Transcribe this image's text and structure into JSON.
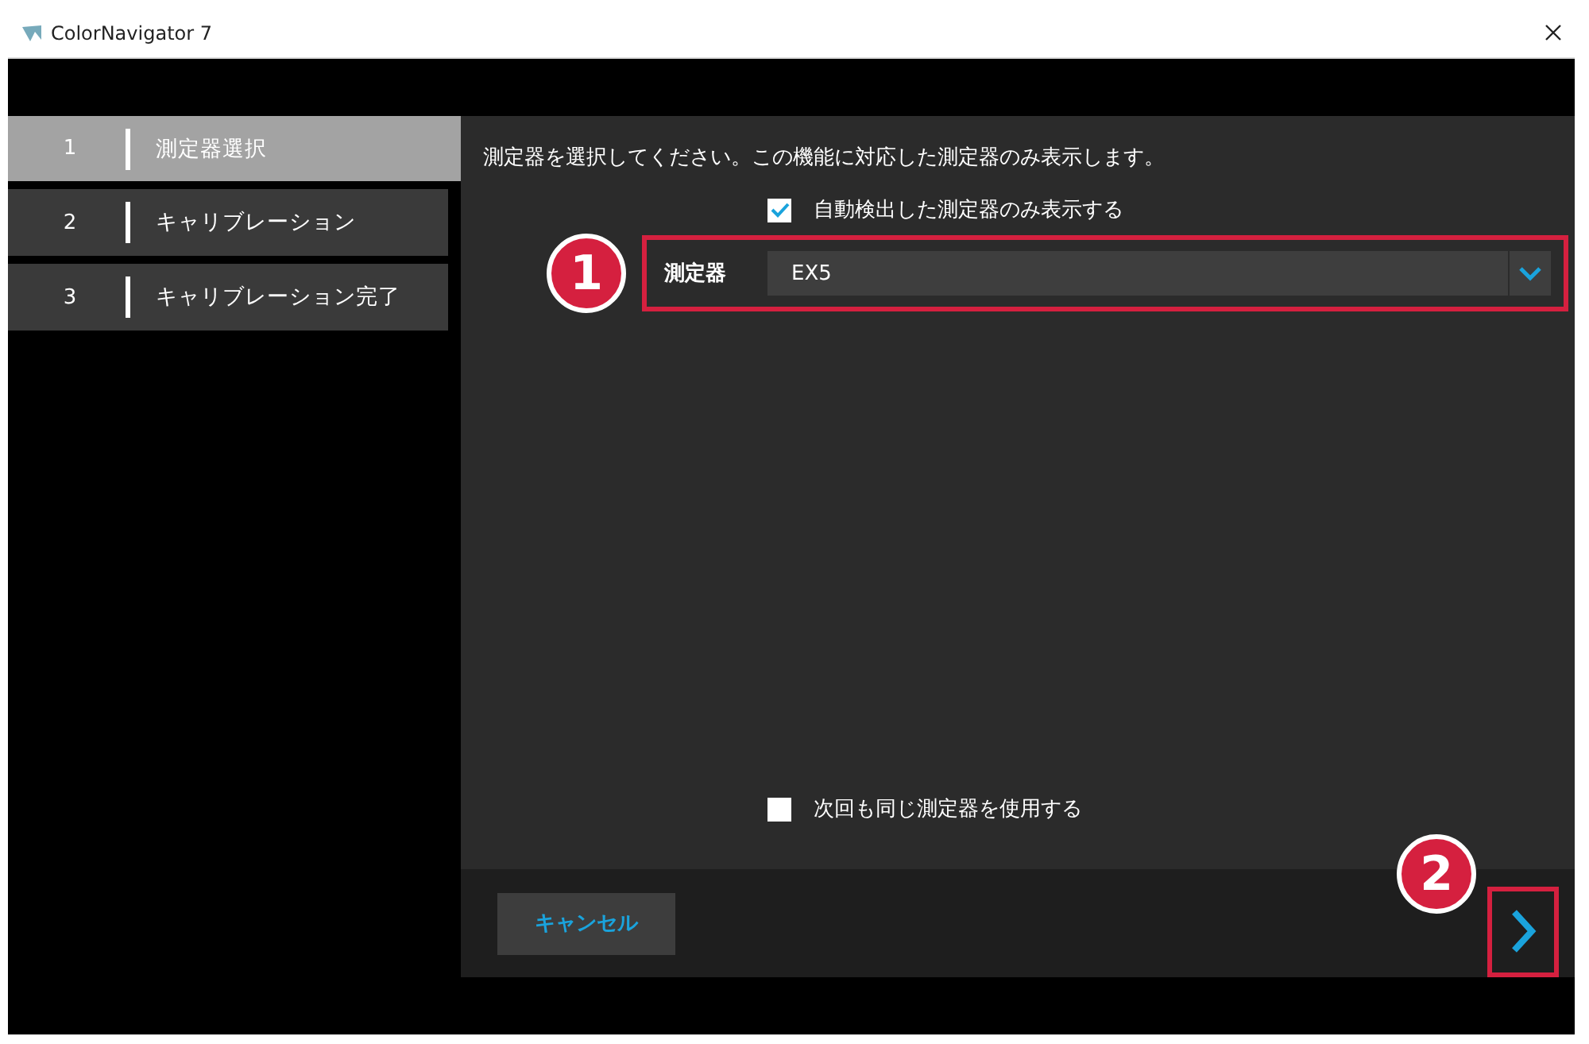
{
  "window": {
    "title": "ColorNavigator 7"
  },
  "steps": [
    {
      "number": "1",
      "label": "測定器選択",
      "selected": true
    },
    {
      "number": "2",
      "label": "キャリブレーション",
      "selected": false
    },
    {
      "number": "3",
      "label": "キャリブレーション完了",
      "selected": false
    }
  ],
  "instruction": "測定器を選択してください。この機能に対応した測定器のみ表示します。",
  "auto_detect": {
    "label": "自動検出した測定器のみ表示する",
    "checked": true
  },
  "device": {
    "label": "測定器",
    "value": "EX5"
  },
  "remember": {
    "label": "次回も同じ測定器を使用する",
    "checked": false
  },
  "cancel_button": "キャンセル",
  "callouts": [
    "1",
    "2"
  ]
}
